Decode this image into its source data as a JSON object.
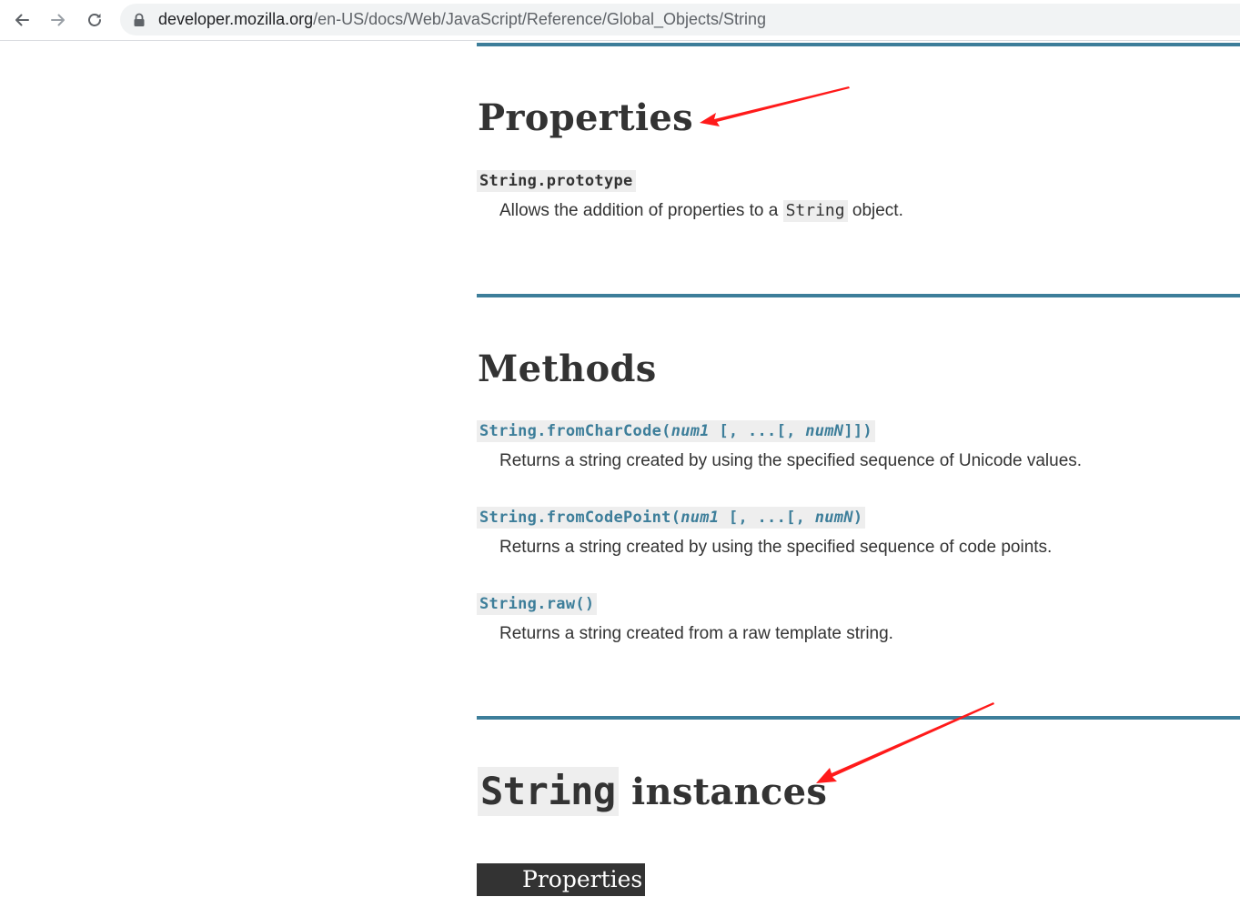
{
  "browser": {
    "url_host": "developer.mozilla.org",
    "url_path": "/en-US/docs/Web/JavaScript/Reference/Global_Objects/String",
    "icons": {
      "back": "arrow-left-icon",
      "forward": "arrow-right-icon",
      "reload": "reload-icon",
      "secure": "lock-icon"
    }
  },
  "properties": {
    "heading": "Properties",
    "items": [
      {
        "term": "String.prototype",
        "desc_before": "Allows the addition of properties to a ",
        "desc_code": "String",
        "desc_after": " object."
      }
    ]
  },
  "methods": {
    "heading": "Methods",
    "items": [
      {
        "name": "String.fromCharCode(",
        "arg1": "num1",
        "mid": " [, ...[, ",
        "arg2": "numN",
        "end": "]])",
        "desc": "Returns a string created by using the specified sequence of Unicode values."
      },
      {
        "name": "String.fromCodePoint(",
        "arg1": "num1",
        "mid": " [, ...[, ",
        "arg2": "numN",
        "end": ")",
        "desc": "Returns a string created by using the specified sequence of code points."
      },
      {
        "name": "String.raw()",
        "desc": "Returns a string created from a raw template string."
      }
    ]
  },
  "instances": {
    "heading_code": "String",
    "heading_text": "instances",
    "subheading": "Properties"
  },
  "colors": {
    "rule": "#3d7e9a",
    "link": "#3d7e9a",
    "text": "#333333",
    "code_bg": "#eeeeee",
    "annotation_arrow": "#ff1a1a"
  }
}
